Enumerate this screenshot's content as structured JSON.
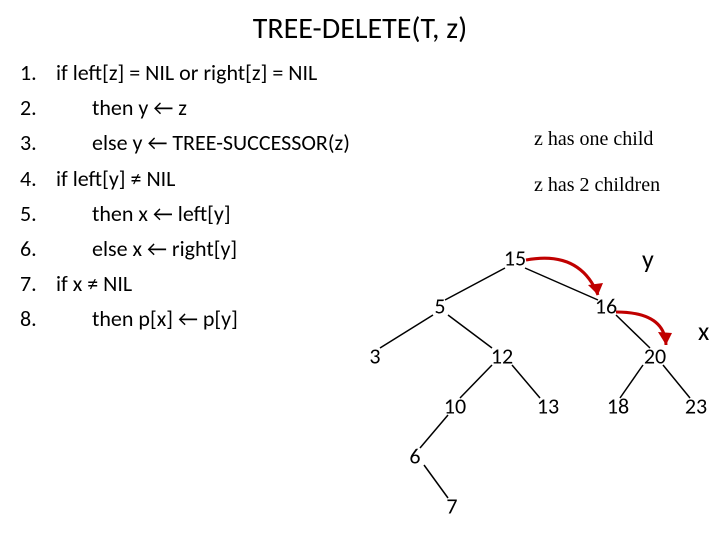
{
  "title": "TREE-DELETE(T, z)",
  "steps": [
    {
      "n": "1.",
      "t": "if left[z] = NIL or right[z] = NIL"
    },
    {
      "n": "2.",
      "t": "then y ← z",
      "indent": true
    },
    {
      "n": "3.",
      "t": "else y ← TREE-SUCCESSOR(z)",
      "indent": true
    },
    {
      "n": "4.",
      "t": "if left[y] ≠ NIL"
    },
    {
      "n": "5.",
      "t": "then x ← left[y]",
      "indent": true
    },
    {
      "n": "6.",
      "t": "else x ← right[y]",
      "indent": true
    },
    {
      "n": "7.",
      "t": "if x ≠ NIL"
    },
    {
      "n": "8.",
      "t": "then p[x] ← p[y]",
      "indent": true
    }
  ],
  "annotations": {
    "one_child": "z has one child",
    "two_child": "z has 2 children"
  },
  "tree": {
    "nodes": {
      "n15": "15",
      "n5": "5",
      "n16": "16",
      "n3": "3",
      "n12": "12",
      "n20": "20",
      "n10": "10",
      "n13": "13",
      "n18": "18",
      "n23": "23",
      "n6": "6",
      "n7": "7"
    },
    "labels": {
      "y": "y",
      "x": "x"
    }
  }
}
